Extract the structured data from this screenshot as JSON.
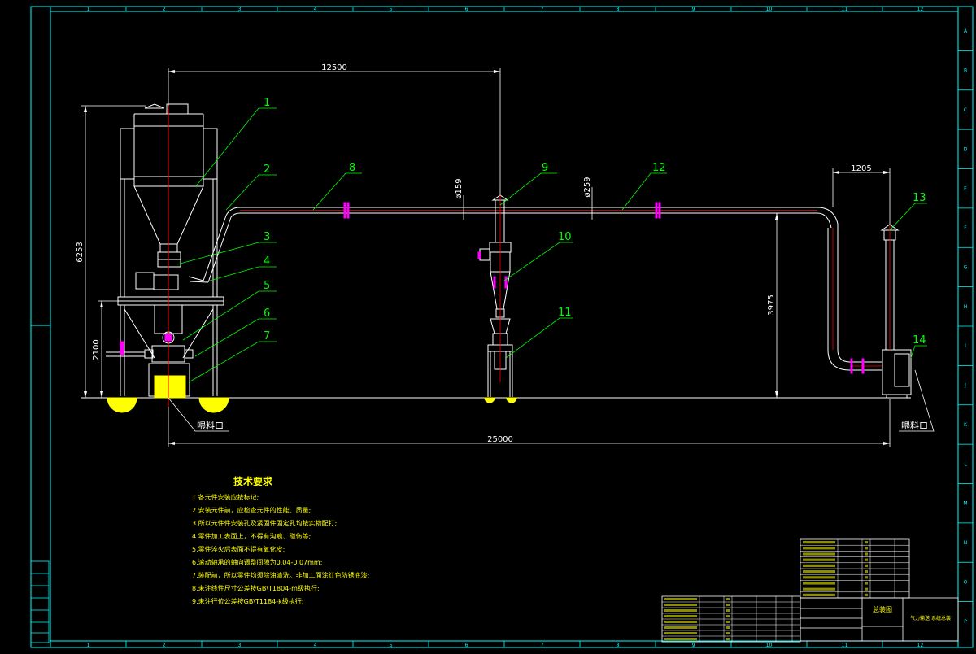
{
  "colors": {
    "background": "#000000",
    "frame": "#00ffff",
    "equipment": "#ffffff",
    "dimension": "#ffffff",
    "leader": "#00ff00",
    "pipe_center": "#ff0000",
    "flange": "#ff00ff",
    "foundation": "#ffff00",
    "text_green": "#00ff00"
  },
  "border": {
    "top_numbers": [
      "1",
      "2",
      "3",
      "4",
      "5",
      "6",
      "7",
      "8",
      "9",
      "10",
      "11",
      "12"
    ],
    "bottom_numbers": [
      "1",
      "2",
      "3",
      "4",
      "5",
      "6",
      "7",
      "8",
      "9",
      "10",
      "11",
      "12"
    ],
    "right_letters": [
      "A",
      "B",
      "C",
      "D",
      "E",
      "F",
      "G",
      "H",
      "I",
      "J",
      "K",
      "L",
      "M",
      "N",
      "O",
      "P"
    ]
  },
  "dimensions": {
    "top_span": "12500",
    "overall_length": "25000",
    "total_height": "6253",
    "frame_height": "2100",
    "pipe_height": "3975",
    "right_offset": "1205",
    "pipe_diameter_1": "ø159",
    "pipe_diameter_2": "ø259"
  },
  "callouts": [
    "1",
    "2",
    "3",
    "4",
    "5",
    "6",
    "7",
    "8",
    "9",
    "10",
    "11",
    "12",
    "13",
    "14"
  ],
  "inlet_labels": [
    "喂料口",
    "喂料口"
  ],
  "tech_requirements": {
    "title": "技术要求",
    "items": [
      "1.各元件安装应按标记;",
      "2.安装元件前，应检查元件的性能、质量;",
      "3.所以元件件安装孔及紧固件固定孔均按实物配打;",
      "4.零件加工表面上，不得有沟痕、碰伤等;",
      "5.零件淬火后表面不得有氧化皮;",
      "6.滚动轴承的轴向调整间隙为0.04-0.07mm;",
      "7.装配前，所以零件均须除油清洗。非加工面涂红色防锈底漆;",
      "8.未注线性尺寸公差按GB\\T1804-m级执行;",
      "9.未注行位公差按GB\\T1184-k级执行;"
    ]
  },
  "title_block": {
    "drawing_name": "总装图",
    "right_note": "气力输送\n系统总装"
  }
}
